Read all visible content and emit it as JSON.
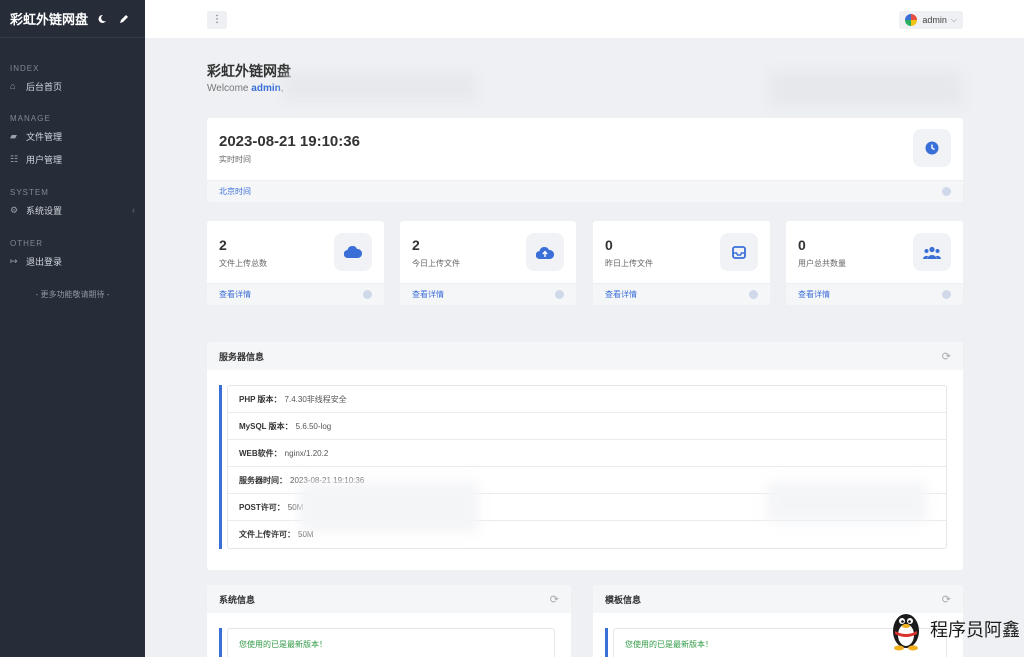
{
  "sidebar": {
    "title": "彩虹外链网盘",
    "sections": [
      {
        "label": "INDEX",
        "items": [
          {
            "label": "后台首页",
            "icon": "home-icon"
          }
        ]
      },
      {
        "label": "MANAGE",
        "items": [
          {
            "label": "文件管理",
            "icon": "folder-icon"
          },
          {
            "label": "用户管理",
            "icon": "users-icon"
          }
        ]
      },
      {
        "label": "SYSTEM",
        "items": [
          {
            "label": "系统设置",
            "icon": "gear-icon"
          }
        ]
      },
      {
        "label": "OTHER",
        "items": [
          {
            "label": "退出登录",
            "icon": "logout-icon"
          }
        ]
      }
    ],
    "more": "- 更多功能敬请期待 -"
  },
  "topbar": {
    "user": "admin"
  },
  "header": {
    "title": "彩虹外链网盘",
    "welcome_prefix": "Welcome ",
    "welcome_user": "admin",
    "welcome_suffix": ","
  },
  "clock": {
    "value": "2023-08-21 19:10:36",
    "label": "实时时间",
    "footer": "北京时间"
  },
  "stats": [
    {
      "value": "2",
      "label": "文件上传总数",
      "link": "查看详情",
      "icon": "cloud-icon"
    },
    {
      "value": "2",
      "label": "今日上传文件",
      "link": "查看详情",
      "icon": "cloud-upload-icon"
    },
    {
      "value": "0",
      "label": "昨日上传文件",
      "link": "查看详情",
      "icon": "inbox-icon"
    },
    {
      "value": "0",
      "label": "用户总共数量",
      "link": "查看详情",
      "icon": "users-icon"
    }
  ],
  "server": {
    "title": "服务器信息",
    "rows": [
      {
        "key": "PHP 版本：",
        "value": "7.4.30非线程安全"
      },
      {
        "key": "MySQL 版本：",
        "value": "5.6.50-log"
      },
      {
        "key": "WEB软件：",
        "value": "nginx/1.20.2"
      },
      {
        "key": "服务器时间：",
        "value": "2023-08-21 19:10:36"
      },
      {
        "key": "POST许可：",
        "value": "50M"
      },
      {
        "key": "文件上传许可：",
        "value": "50M"
      }
    ]
  },
  "system_panel": {
    "title": "系统信息",
    "notice": "您使用的已是最新版本！"
  },
  "template_panel": {
    "title": "模板信息",
    "notice": "您使用的已是最新版本！"
  },
  "watermark": "程序员阿鑫",
  "colors": {
    "accent": "#3a6fd8",
    "sidebar": "#262d38",
    "success": "#2e9a43"
  }
}
